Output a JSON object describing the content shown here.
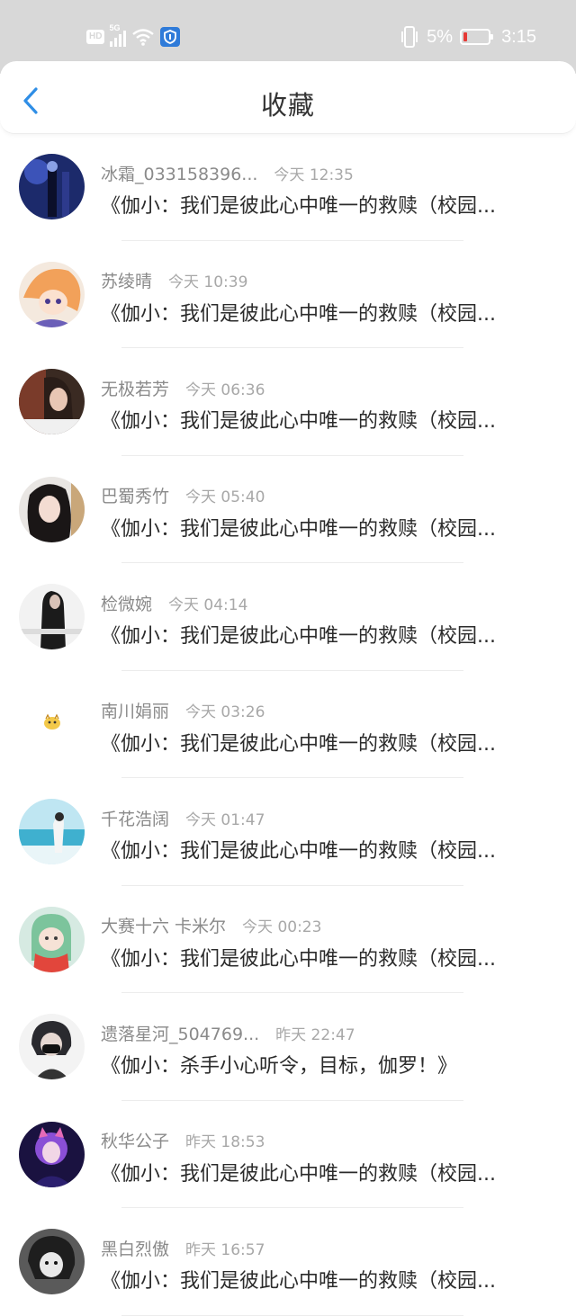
{
  "status_bar": {
    "network": "5G",
    "hd_label": "HD",
    "battery_percent": "5%",
    "time": "3:15",
    "battery_color": "#e53935",
    "shield_color": "#2f7bd9"
  },
  "header": {
    "title": "收藏",
    "back_icon": "chevron-left-icon",
    "accent": "#2f8ee6"
  },
  "items": [
    {
      "name": "冰霜_033158396...",
      "time": "今天 12:35",
      "message": "《伽小：我们是彼此心中唯一的救赎（校园..."
    },
    {
      "name": "苏绫晴",
      "time": "今天 10:39",
      "message": "《伽小：我们是彼此心中唯一的救赎（校园..."
    },
    {
      "name": "无极若芳",
      "time": "今天 06:36",
      "message": "《伽小：我们是彼此心中唯一的救赎（校园..."
    },
    {
      "name": "巴蜀秀竹",
      "time": "今天 05:40",
      "message": "《伽小：我们是彼此心中唯一的救赎（校园..."
    },
    {
      "name": "检微婉",
      "time": "今天 04:14",
      "message": "《伽小：我们是彼此心中唯一的救赎（校园..."
    },
    {
      "name": "南川娟丽",
      "time": "今天 03:26",
      "message": "《伽小：我们是彼此心中唯一的救赎（校园..."
    },
    {
      "name": "千花浩阔",
      "time": "今天 01:47",
      "message": "《伽小：我们是彼此心中唯一的救赎（校园..."
    },
    {
      "name": "大赛十六 卡米尔",
      "time": "今天 00:23",
      "message": "《伽小：我们是彼此心中唯一的救赎（校园..."
    },
    {
      "name": "遗落星河_504769...",
      "time": "昨天 22:47",
      "message": "《伽小：杀手小心听令，目标，伽罗！》"
    },
    {
      "name": "秋华公子",
      "time": "昨天 18:53",
      "message": "《伽小：我们是彼此心中唯一的救赎（校园..."
    },
    {
      "name": "黑白烈傲",
      "time": "昨天 16:57",
      "message": "《伽小：我们是彼此心中唯一的救赎（校园..."
    }
  ]
}
